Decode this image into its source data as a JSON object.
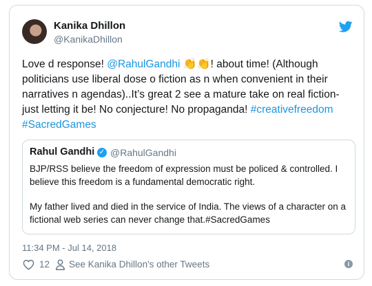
{
  "tweet": {
    "author_name": "Kanika Dhillon",
    "author_handle": "@KanikaDhillon",
    "text_1": "Love d response! ",
    "mention": "@RahulGandhi",
    "claps": "👏👏",
    "text_2": "!  about time! (Although politicians use liberal dose o fiction as n when convenient in their narratives n agendas)..It’s great 2 see a mature take on real fiction- just letting it be! No conjecture! No propaganda! ",
    "hashtag_1": "#creativefreedom",
    "hashtag_2": "#SacredGames",
    "timestamp": "11:34 PM - Jul 14, 2018",
    "likes": "12",
    "other_tweets": "See Kanika Dhillon's other Tweets"
  },
  "quoted": {
    "author_name": "Rahul Gandhi",
    "author_handle": "@RahulGandhi",
    "paragraph_1": "BJP/RSS believe the freedom of expression must be policed & controlled. I believe this freedom is a fundamental democratic right.",
    "paragraph_2": "My father lived and died in the service of India. The views of a character on a fictional web series can never change that.#SacredGames"
  },
  "colors": {
    "link": "#1b95e0",
    "twitter_blue": "#1da1f2",
    "muted": "#657786"
  },
  "icons": [
    "twitter-bird-icon",
    "verified-badge-icon",
    "heart-icon",
    "person-icon",
    "info-icon"
  ]
}
